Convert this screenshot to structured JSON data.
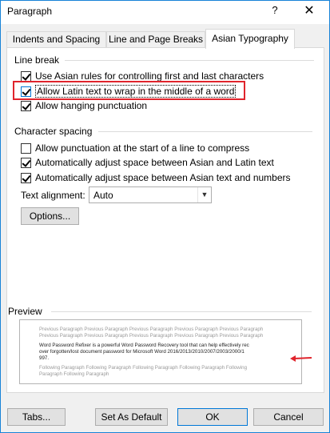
{
  "window": {
    "title": "Paragraph",
    "help_glyph": "?",
    "close_glyph": "✕"
  },
  "tabs": [
    {
      "label": "Indents and Spacing"
    },
    {
      "label": "Line and Page Breaks"
    },
    {
      "label": "Asian Typography"
    }
  ],
  "line_break": {
    "heading": "Line break",
    "items": [
      {
        "label": "Use Asian rules for controlling first and last characters",
        "checked": true
      },
      {
        "label": "Allow Latin text to wrap in the middle of a word",
        "checked": true
      },
      {
        "label": "Allow hanging punctuation",
        "checked": true
      }
    ]
  },
  "char_spacing": {
    "heading": "Character spacing",
    "items": [
      {
        "label": "Allow punctuation at the start of a line to compress",
        "checked": false
      },
      {
        "label": "Automatically adjust space between Asian and Latin text",
        "checked": true
      },
      {
        "label": "Automatically adjust space between Asian text and numbers",
        "checked": true
      }
    ],
    "alignment_label": "Text alignment:",
    "alignment_value": "Auto",
    "options_button": "Options..."
  },
  "preview": {
    "heading": "Preview",
    "prev_lines": [
      "Previous Paragraph Previous Paragraph Previous Paragraph Previous Paragraph Previous Paragraph",
      "Previous Paragraph Previous Paragraph Previous Paragraph Previous Paragraph Previous Paragraph"
    ],
    "body_lines": [
      "Word Password Refixer is a powerful Word Password Recovery tool that can help effectively rec",
      "over forgotten/lost document password for Microsoft Word 2016/2013/2010/2007/2003/2000/1",
      "997."
    ],
    "next_lines": [
      "Following Paragraph Following Paragraph Following Paragraph Following Paragraph Following",
      "Paragraph Following Paragraph"
    ]
  },
  "buttons": {
    "tabs": "Tabs...",
    "set_default": "Set As Default",
    "ok": "OK",
    "cancel": "Cancel"
  },
  "colors": {
    "highlight": "#e0242c",
    "accent": "#0078d7"
  }
}
